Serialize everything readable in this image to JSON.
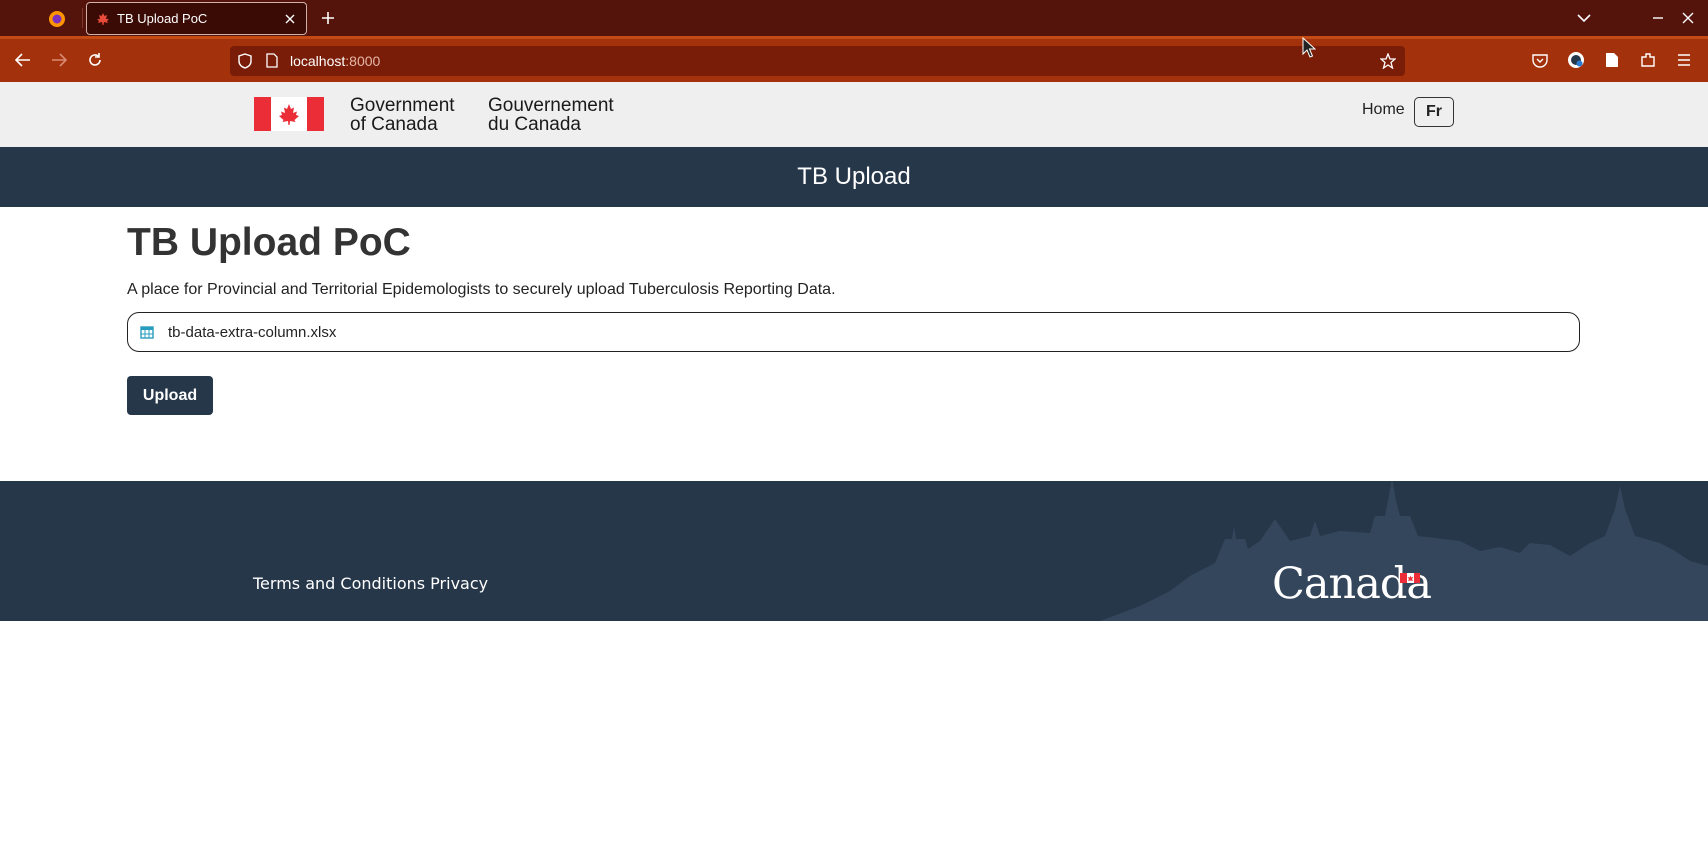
{
  "browser": {
    "tab_title": "TB Upload PoC",
    "url_host": "localhost",
    "url_port": ":8000"
  },
  "header": {
    "signature_en_line1": "Government",
    "signature_en_line2": "of Canada",
    "signature_fr_line1": "Gouvernement",
    "signature_fr_line2": "du Canada",
    "home_link": "Home",
    "lang_toggle": "Fr"
  },
  "banner": {
    "title": "TB Upload"
  },
  "main": {
    "title": "TB Upload PoC",
    "intro": "A place for Provincial and Territorial Epidemologists to securely upload Tuberculosis Reporting Data.",
    "file_name": "tb-data-extra-column.xlsx",
    "upload_label": "Upload"
  },
  "footer": {
    "link_terms": "Terms and Conditions",
    "link_privacy": "Privacy",
    "wordmark": "Canada"
  },
  "colors": {
    "browser_tabbar": "#54130b",
    "browser_navbar": "#a3320c",
    "gc_header_bg": "#efefef",
    "banner_bg": "#26374a",
    "canada_red": "#eb2d37"
  },
  "icons": [
    "firefox-icon",
    "maple-leaf-favicon",
    "close-icon",
    "plus-icon",
    "chevron-down-icon",
    "minimize-icon",
    "window-close-icon",
    "back-arrow-icon",
    "forward-arrow-icon",
    "reload-icon",
    "shield-icon",
    "page-icon",
    "star-icon",
    "pocket-icon",
    "account-icon",
    "reader-icon",
    "extensions-icon",
    "menu-icon",
    "spreadsheet-icon"
  ]
}
